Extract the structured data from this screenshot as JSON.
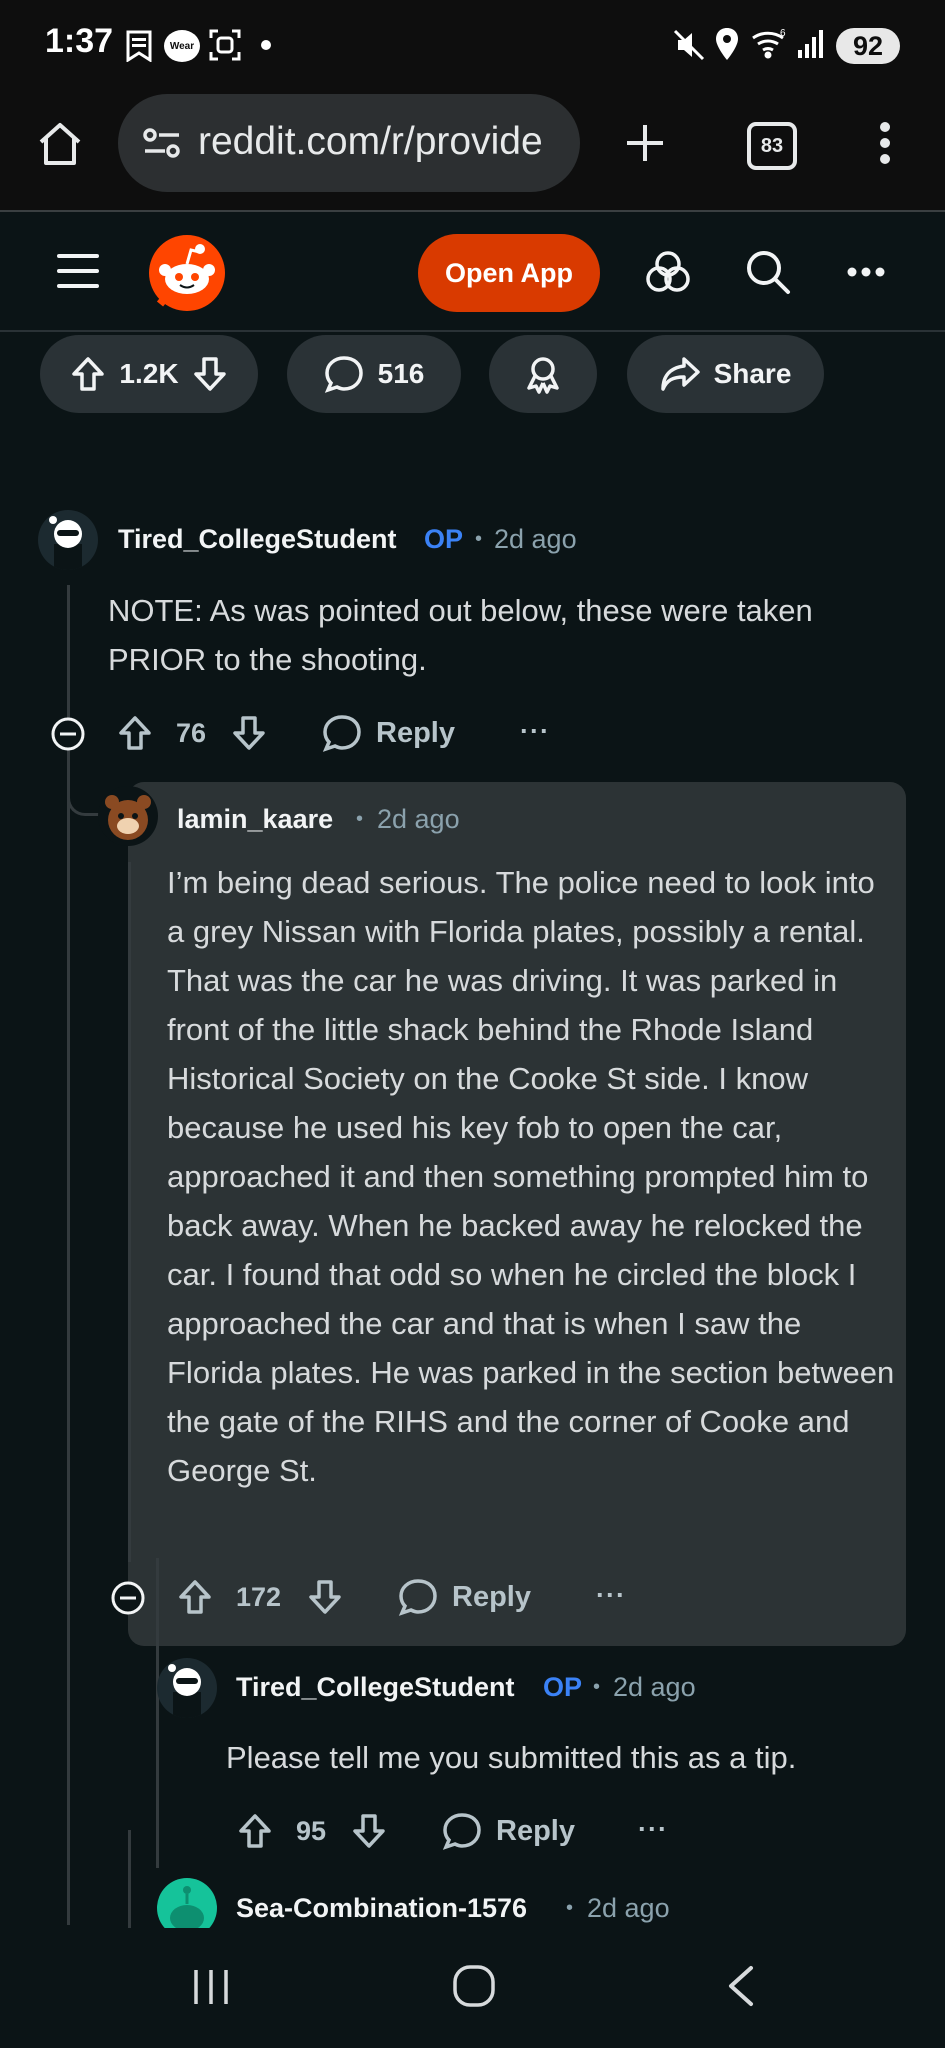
{
  "status_bar": {
    "time": "1:37",
    "wear_label": "Wear",
    "battery": "92"
  },
  "browser": {
    "url": "reddit.com/r/provide",
    "tab_count": "83"
  },
  "reddit_header": {
    "open_app_label": "Open App"
  },
  "post_actions": {
    "upvotes": "1.2K",
    "comments": "516",
    "share_label": "Share"
  },
  "comments": [
    {
      "username": "Tired_CollegeStudent",
      "op_label": "OP",
      "age": "2d ago",
      "body": "NOTE: As was pointed out below, these were taken PRIOR to the shooting.",
      "votes": "76",
      "reply_label": "Reply",
      "more": "···"
    },
    {
      "username": "lamin_kaare",
      "age": "2d ago",
      "body": "I’m being dead serious. The police need to look into a grey Nissan with Florida plates, possibly a rental. That was the car he was driving. It was parked in front of the little shack behind the Rhode Island Historical Society on the Cooke St side. I know because he used his key fob to open the car, approached it and then something prompted him to back away. When he backed away he relocked the car. I found that odd so when he circled the block I approached the car and that is when I saw the Florida plates. He was parked in the section between the gate of the RIHS and the corner of Cooke and George St.",
      "votes": "172",
      "reply_label": "Reply",
      "more": "···"
    },
    {
      "username": "Tired_CollegeStudent",
      "op_label": "OP",
      "age": "2d ago",
      "body": "Please tell me you submitted this as a tip.",
      "votes": "95",
      "reply_label": "Reply",
      "more": "···"
    },
    {
      "username": "Sea-Combination-1576",
      "age": "2d ago"
    }
  ],
  "colors": {
    "background": "#0b1416",
    "accent": "#d93a00",
    "op": "#3b82f6",
    "highlight": "#2c3335"
  }
}
